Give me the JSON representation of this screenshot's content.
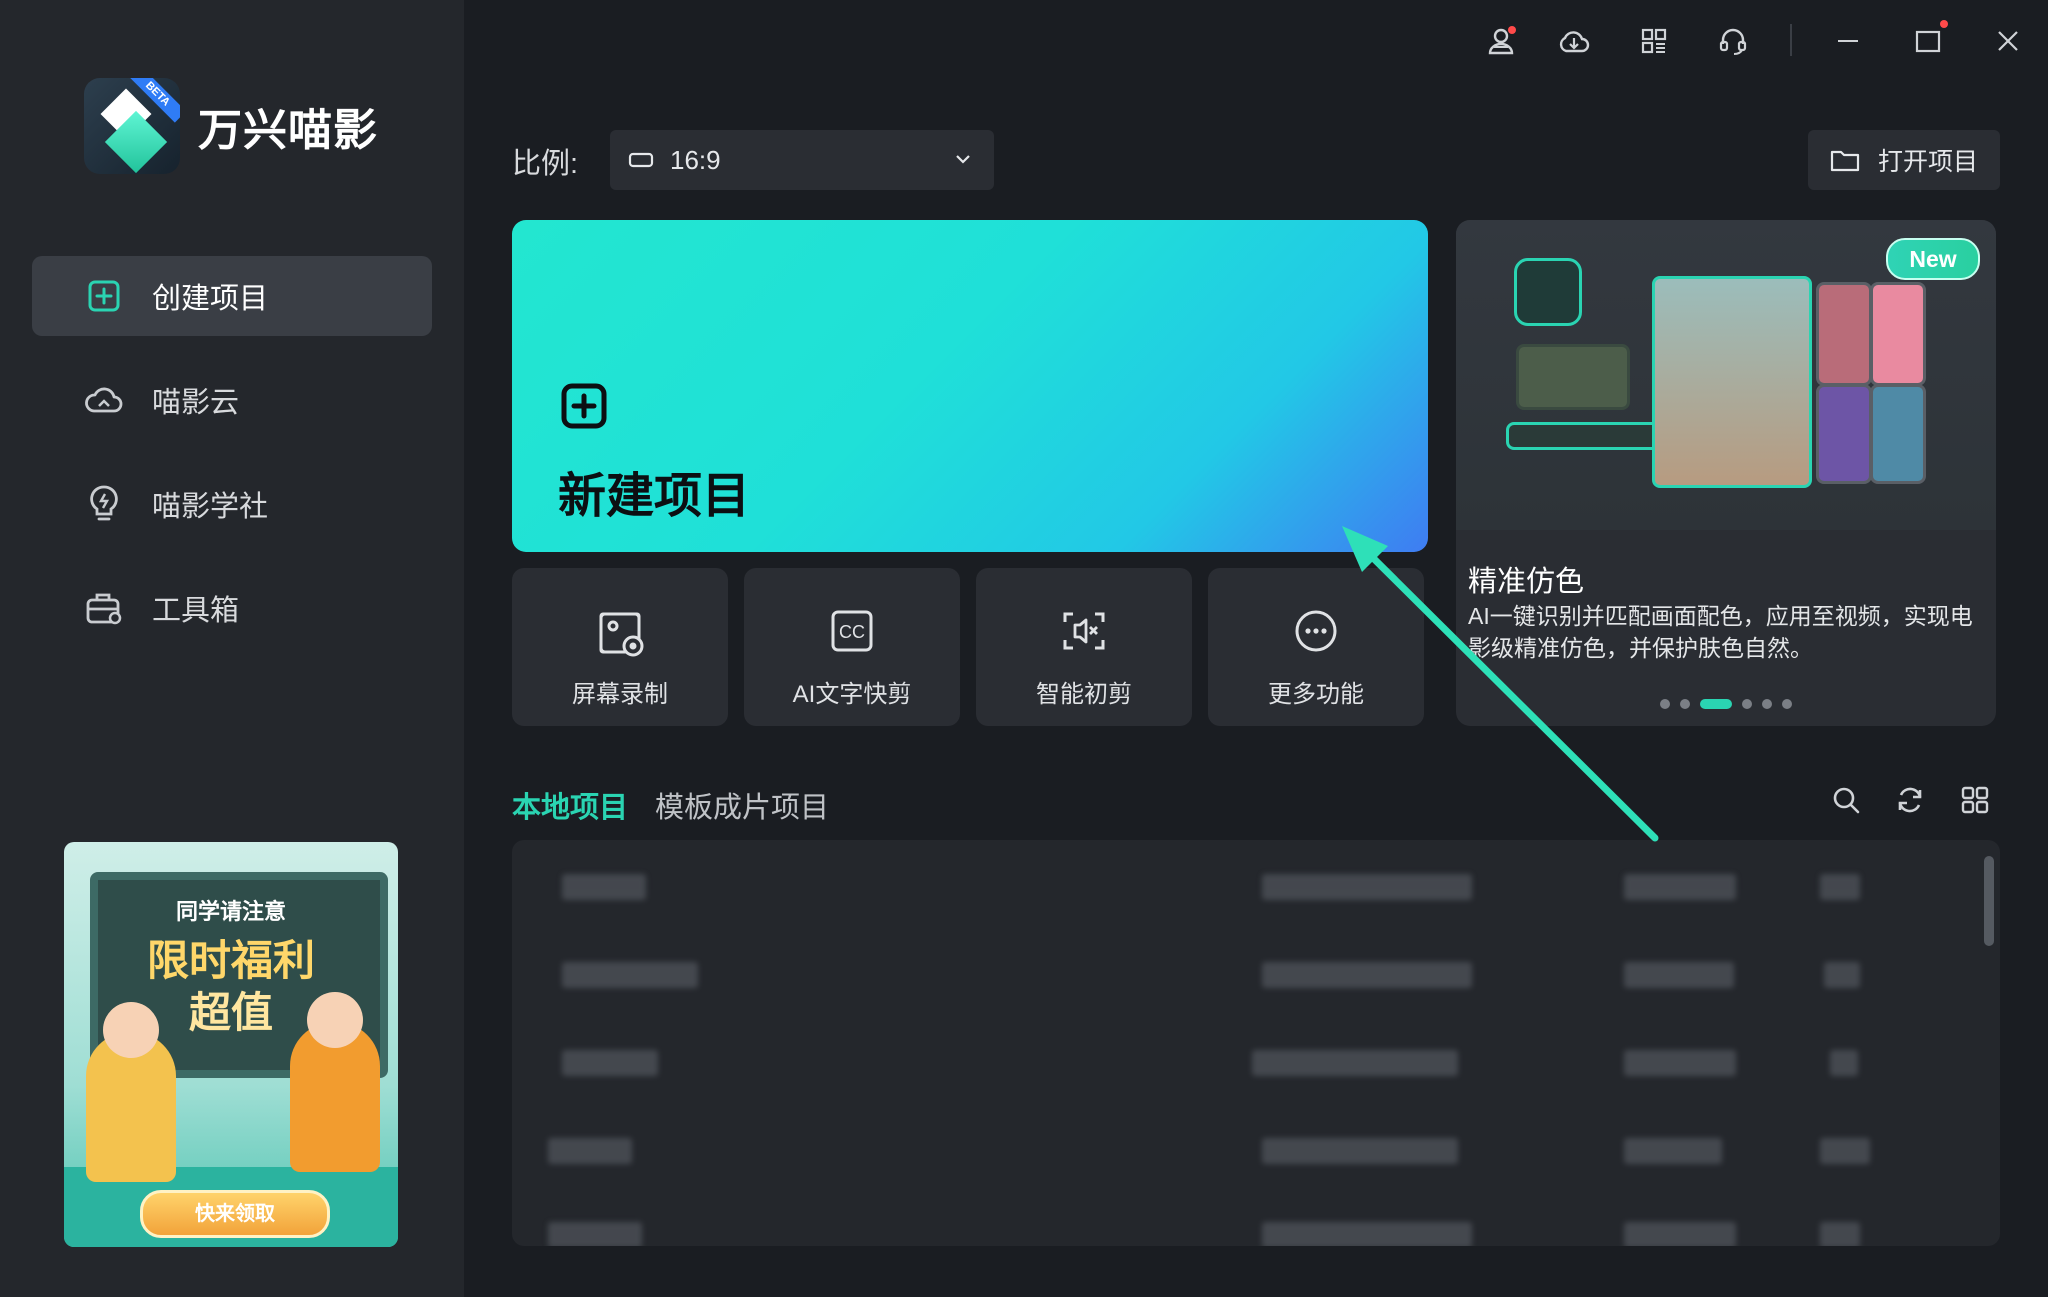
{
  "app": {
    "name": "万兴喵影",
    "badge": "BETA"
  },
  "sidebar": {
    "items": [
      {
        "label": "创建项目",
        "icon": "plus-square-icon",
        "active": true
      },
      {
        "label": "喵影云",
        "icon": "cloud-icon",
        "active": false
      },
      {
        "label": "喵影学社",
        "icon": "lightbulb-icon",
        "active": false
      },
      {
        "label": "工具箱",
        "icon": "toolbox-icon",
        "active": false
      }
    ],
    "promo": {
      "line1": "同学请注意",
      "line2": "限时福利",
      "line3": "超值",
      "button": "快来领取"
    }
  },
  "titlebar": {
    "icons": [
      "account-icon",
      "cloud-upload-icon",
      "apps-grid-icon",
      "headset-support-icon",
      "minimize-icon",
      "maximize-icon",
      "close-icon"
    ]
  },
  "toolbar": {
    "ratio_label": "比例:",
    "ratio_value": "16:9",
    "open_project": "打开项目"
  },
  "new_project": {
    "label": "新建项目"
  },
  "tools": [
    {
      "label": "屏幕录制",
      "icon": "screen-record-icon"
    },
    {
      "label": "AI文字快剪",
      "icon": "cc-caption-icon"
    },
    {
      "label": "智能初剪",
      "icon": "smart-cut-icon"
    },
    {
      "label": "更多功能",
      "icon": "more-icon"
    }
  ],
  "banner": {
    "badge": "New",
    "title": "精准仿色",
    "description": "AI一键识别并匹配画面配色，应用至视频，实现电影级精准仿色，并保护肤色自然。",
    "dots": 6,
    "active_dot": 2
  },
  "projects": {
    "tabs": [
      {
        "label": "本地项目",
        "active": true
      },
      {
        "label": "模板成片项目",
        "active": false
      }
    ],
    "actions": [
      "search-icon",
      "refresh-icon",
      "grid-view-icon"
    ]
  },
  "colors": {
    "accent": "#2ad4b2",
    "background": "#1a1d22",
    "sidebar": "#24272c",
    "card": "#2a2d33"
  }
}
